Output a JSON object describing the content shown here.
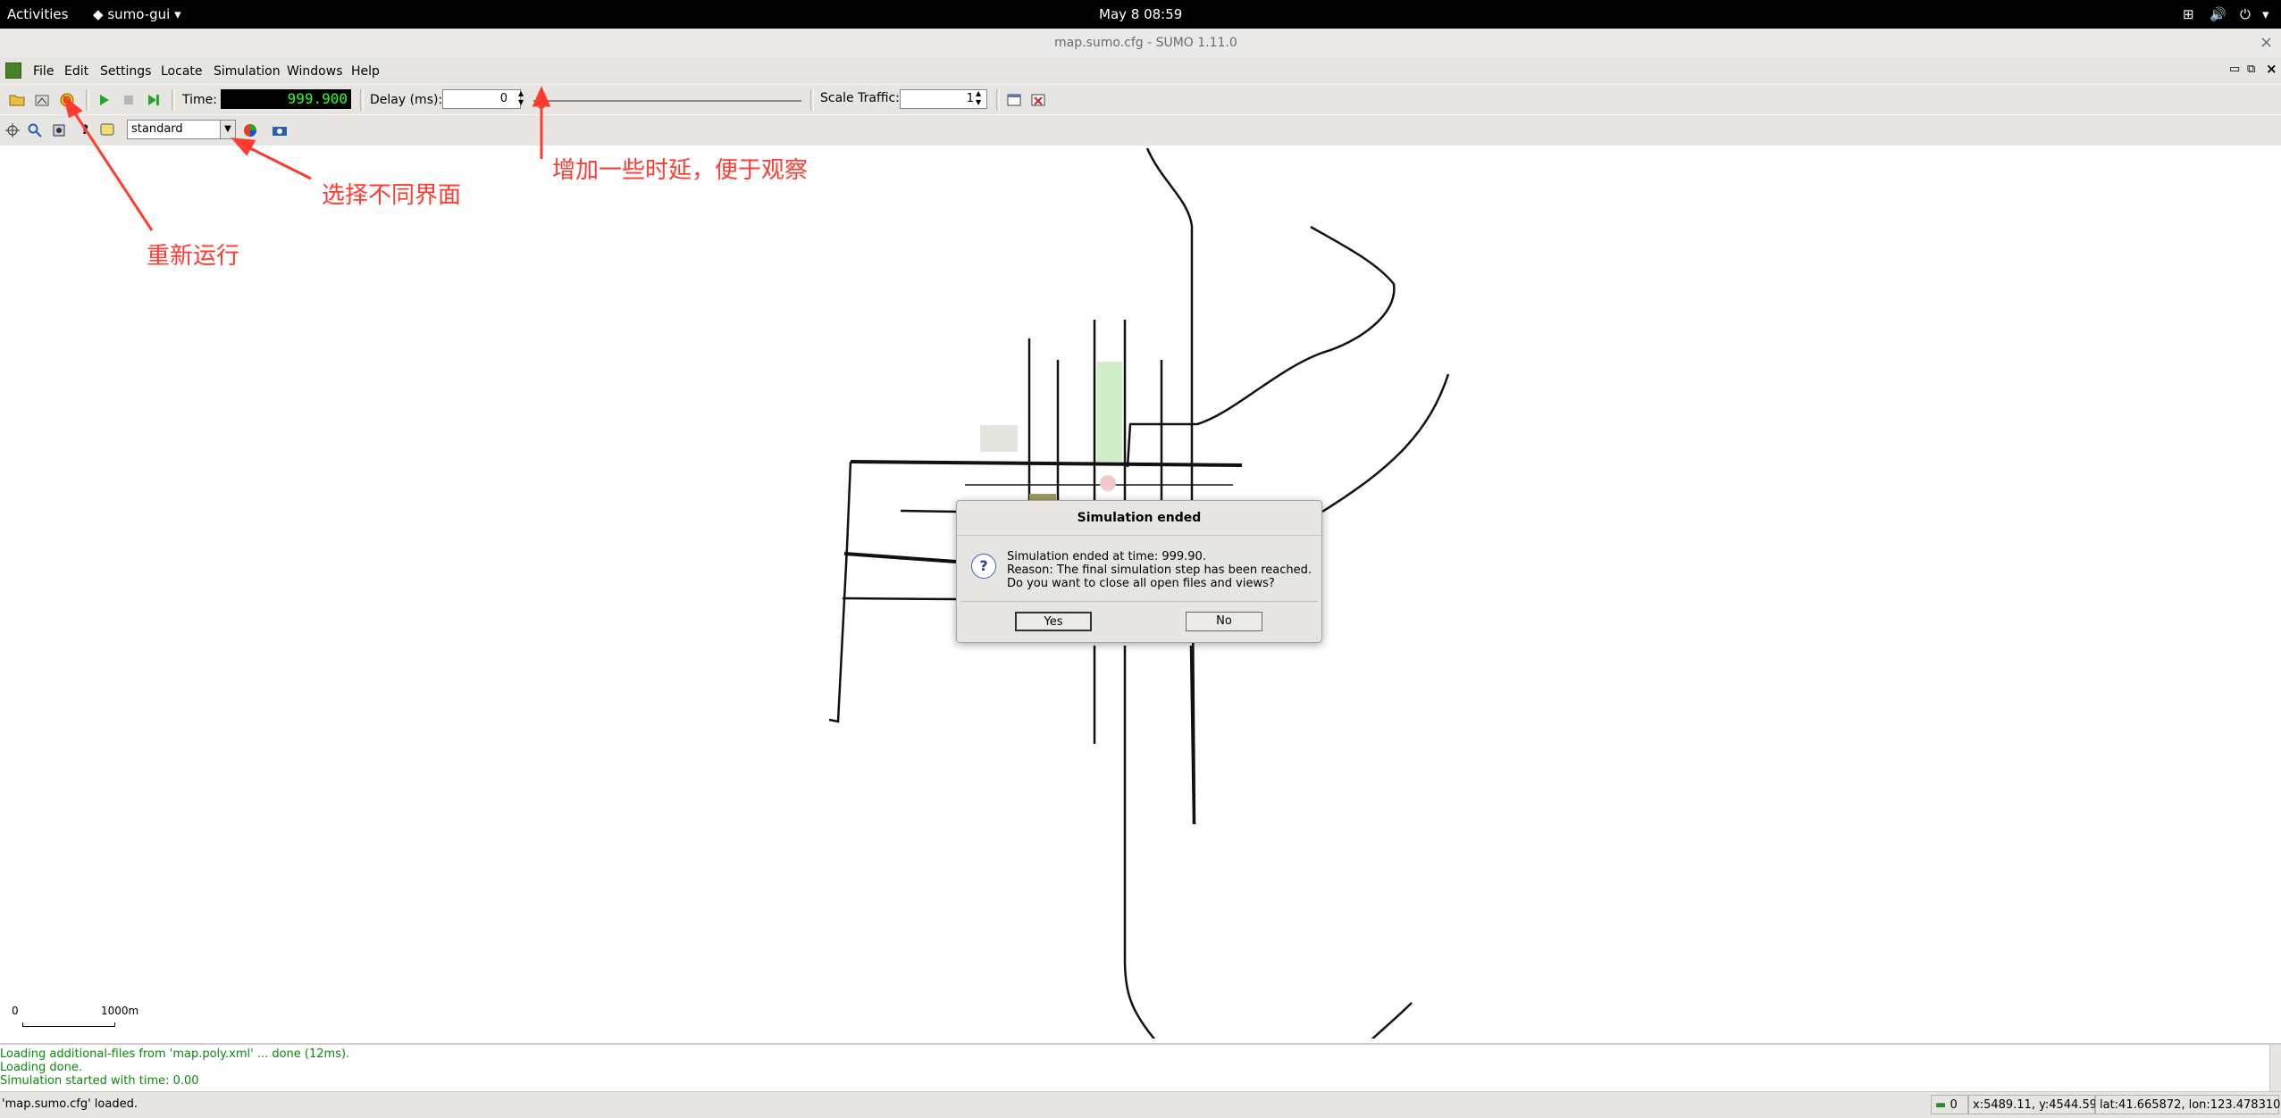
{
  "top_bar": {
    "activities": "Activities",
    "app_menu": "sumo-gui",
    "clock": "May 8  08:59"
  },
  "window": {
    "title": "map.sumo.cfg - SUMO 1.11.0",
    "close_glyph": "×"
  },
  "menu": [
    "File",
    "Edit",
    "Settings",
    "Locate",
    "Simulation",
    "Windows",
    "Help"
  ],
  "toolbar": {
    "time_label": "Time:",
    "time_value": "999.900",
    "delay_label": "Delay (ms):",
    "delay_value": "0",
    "scale_label": "Scale Traffic:",
    "scale_value": "1",
    "scheme_select": "standard"
  },
  "scale_bar": {
    "start": "0",
    "end": "1000m"
  },
  "dialog": {
    "title": "Simulation ended",
    "line1": "Simulation ended at time: 999.90.",
    "line2": "Reason: The final simulation step has been reached.",
    "line3": "Do you want to close all open files and views?",
    "yes": "Yes",
    "no": "No"
  },
  "messages": [
    "Loading additional-files from 'map.poly.xml' ... done (12ms).",
    "Loading done.",
    "Simulation started with time: 0.00"
  ],
  "status": {
    "left": "'map.sumo.cfg' loaded.",
    "vehicles": "0",
    "coords": "x:5489.11, y:4544.59",
    "geo": "lat:41.665872, lon:123.478310"
  },
  "annotations": {
    "rerun": "重新运行",
    "select_view": "选择不同界面",
    "add_delay": "增加一些时延，便于观察",
    "color": "#ff3b30"
  }
}
